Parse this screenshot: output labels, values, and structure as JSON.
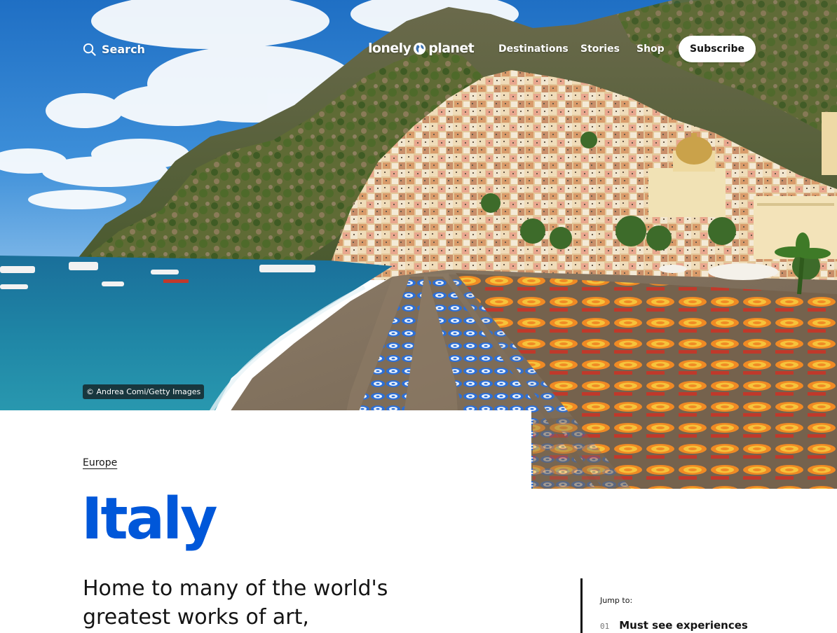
{
  "header": {
    "search_label": "Search",
    "logo_text_left": "lonely",
    "logo_text_right": "planet",
    "nav_items": [
      {
        "label": "Destinations"
      },
      {
        "label": "Stories"
      },
      {
        "label": "Shop"
      }
    ],
    "subscribe_label": "Subscribe"
  },
  "hero": {
    "photo_credit": "© Andrea Comi/Getty Images"
  },
  "content": {
    "breadcrumb_region": "Europe",
    "title": "Italy",
    "intro_line1": "Home to many of the world's",
    "intro_line2": "greatest works of art,"
  },
  "jump_to": {
    "label": "Jump to:",
    "items": [
      {
        "number": "01",
        "label": "Must see experiences"
      }
    ]
  },
  "colors": {
    "brand_blue": "#0057d9",
    "text": "#141414",
    "white": "#ffffff"
  }
}
